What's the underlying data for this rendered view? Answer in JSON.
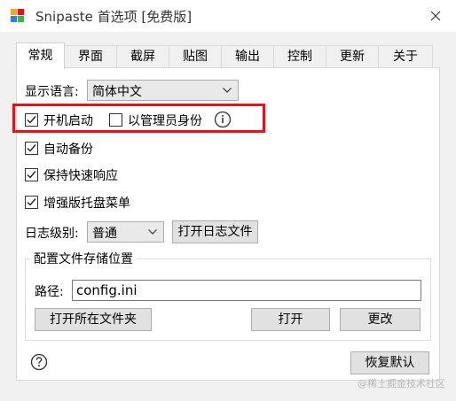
{
  "window": {
    "title": "Snipaste 首选项 [免费版]"
  },
  "tabs": [
    "常规",
    "界面",
    "截屏",
    "贴图",
    "输出",
    "控制",
    "更新",
    "关于"
  ],
  "general": {
    "language_label": "显示语言:",
    "language_value": "简体中文",
    "autostart_label": "开机启动",
    "autostart_checked": true,
    "admin_label": "以管理员身份",
    "admin_checked": false,
    "auto_backup_label": "自动备份",
    "auto_backup_checked": true,
    "keep_responsive_label": "保持快速响应",
    "keep_responsive_checked": true,
    "enhanced_tray_label": "增强版托盘菜单",
    "enhanced_tray_checked": true,
    "log_level_label": "日志级别:",
    "log_level_value": "普通",
    "open_log_button": "打开日志文件",
    "config_group_title": "配置文件存储位置",
    "path_label": "路径:",
    "path_value": "config.ini",
    "open_folder_button": "打开所在文件夹",
    "open_button": "打开",
    "change_button": "更改",
    "restore_defaults_button": "恢复默认"
  },
  "watermark": "@稀土掘金技术社区",
  "colors": {
    "highlight": "#e8101b",
    "logo": [
      "#f5a623",
      "#e8101b",
      "#2e7dd7",
      "#3cb44b"
    ]
  }
}
